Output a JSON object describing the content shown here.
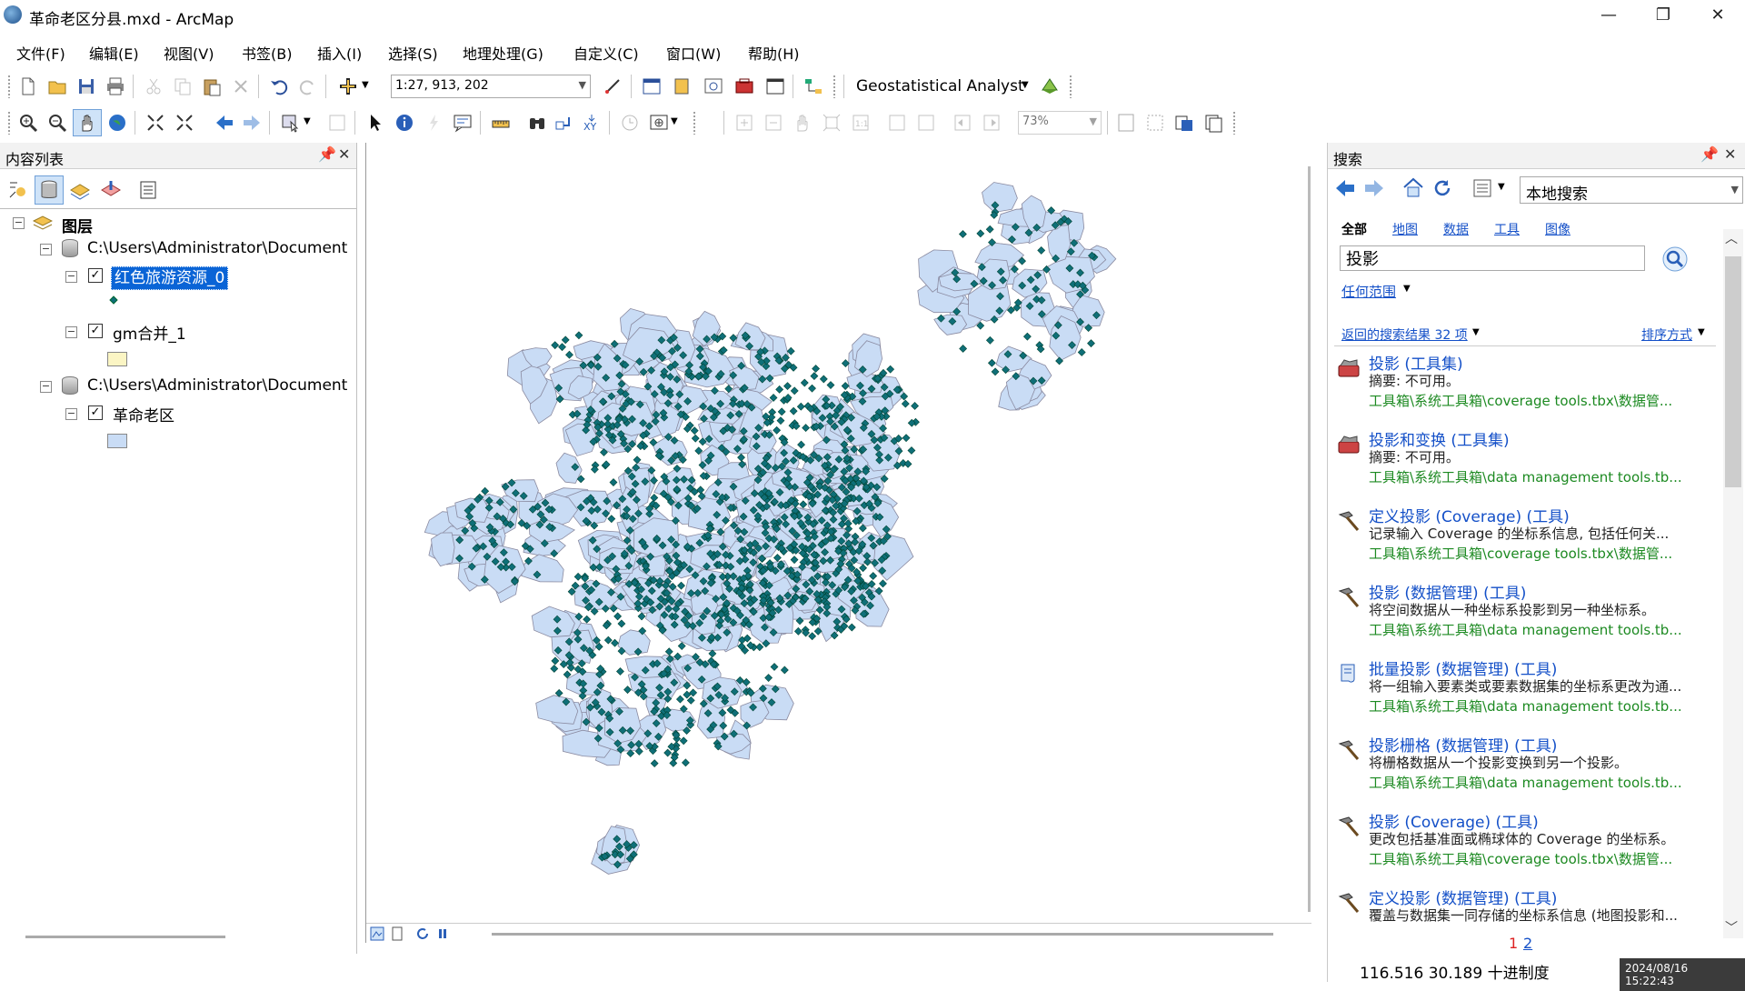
{
  "window": {
    "title": "革命老区分县.mxd - ArcMap",
    "minimize": "—",
    "restore": "❐",
    "close": "✕"
  },
  "menu": [
    "文件(F)",
    "编辑(E)",
    "视图(V)",
    "书签(B)",
    "插入(I)",
    "选择(S)",
    "地理处理(G)",
    "自定义(C)",
    "窗口(W)",
    "帮助(H)"
  ],
  "toolbar": {
    "scale_value": "1:27, 913, 202",
    "geostat_label": "Geostatistical Analyst",
    "zoom_value": "73%"
  },
  "toc": {
    "title": "内容列表",
    "layers_root": "图层",
    "groups": [
      {
        "path": "C:\\Users\\Administrator\\Document",
        "layer": "红色旅游资源_0"
      },
      {
        "layer": "gm合并_1"
      },
      {
        "path": "C:\\Users\\Administrator\\Document",
        "layer": "革命老区"
      }
    ]
  },
  "search": {
    "title": "搜索",
    "scope": "本地搜索",
    "tabs": [
      "全部",
      "地图",
      "数据",
      "工具",
      "图像"
    ],
    "query": "投影",
    "range_link": "任何范围",
    "results_count": "返回的搜索结果 32 项",
    "sort_label": "排序方式",
    "results": [
      {
        "title": "投影 (工具集)",
        "summary": "摘要: 不可用。",
        "path": "工具箱\\系统工具箱\\coverage tools.tbx\\数据管...",
        "icon": "toolset-icon"
      },
      {
        "title": "投影和变换 (工具集)",
        "summary": "摘要: 不可用。",
        "path": "工具箱\\系统工具箱\\data management tools.tb...",
        "icon": "toolset-icon"
      },
      {
        "title": "定义投影 (Coverage) (工具)",
        "summary": "记录输入 Coverage 的坐标系信息, 包括任何关...",
        "path": "工具箱\\系统工具箱\\coverage tools.tbx\\数据管...",
        "icon": "hammer-icon"
      },
      {
        "title": "投影 (数据管理) (工具)",
        "summary": "将空间数据从一种坐标系投影到另一种坐标系。",
        "path": "工具箱\\系统工具箱\\data management tools.tb...",
        "icon": "hammer-icon"
      },
      {
        "title": "批量投影 (数据管理) (工具)",
        "summary": "将一组输入要素类或要素数据集的坐标系更改为通...",
        "path": "工具箱\\系统工具箱\\data management tools.tb...",
        "icon": "script-icon"
      },
      {
        "title": "投影栅格 (数据管理) (工具)",
        "summary": "将栅格数据从一个投影变换到另一个投影。",
        "path": "工具箱\\系统工具箱\\data management tools.tb...",
        "icon": "hammer-icon"
      },
      {
        "title": "投影 (Coverage) (工具)",
        "summary": "更改包括基准面或椭球体的 Coverage 的坐标系。",
        "path": "工具箱\\系统工具箱\\coverage tools.tbx\\数据管...",
        "icon": "hammer-icon"
      },
      {
        "title": "定义投影 (数据管理) (工具)",
        "summary": "覆盖与数据集一同存储的坐标系信息 (地图投影和...",
        "path": "",
        "icon": "hammer-icon"
      }
    ],
    "pages": [
      "1",
      "2"
    ]
  },
  "status": {
    "coords": "116.516  30.189 十进制度",
    "timestamp": "2024/08/16 15:22:43"
  },
  "colors": {
    "polygon_fill": "#c9dcf5",
    "polygon_stroke": "#8a8aa0",
    "point_fill": "#0f6f78",
    "selection": "#0a64d6",
    "link": "#1450c8",
    "path_green": "#1d8a22"
  }
}
